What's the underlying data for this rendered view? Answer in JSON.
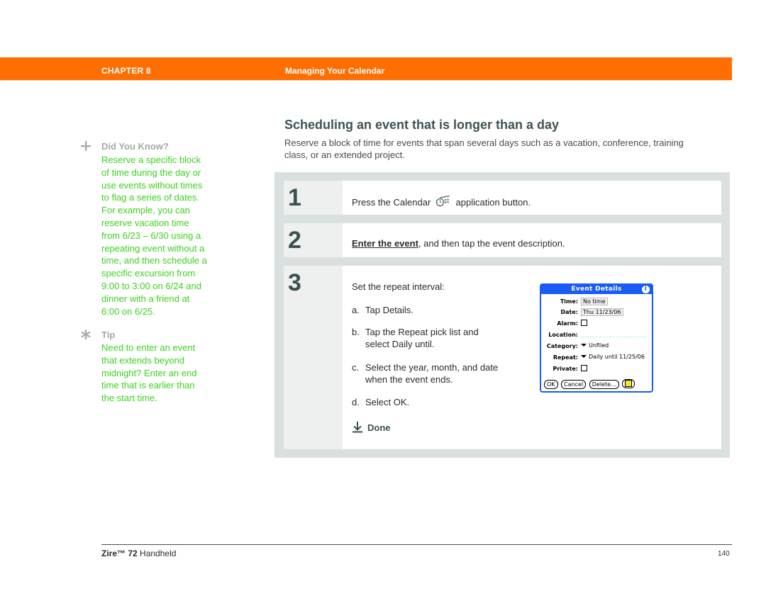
{
  "header": {
    "chapter_label": "CHAPTER 8",
    "chapter_title": "Managing Your Calendar",
    "accent_color": "#ff6e00"
  },
  "sidebar": {
    "did_you_know": {
      "icon": "plus-icon",
      "heading": "Did You Know?",
      "lines": [
        "Reserve a specific block",
        "of time during the day or",
        "use events without times",
        "to flag a series of dates.",
        "For example, you can",
        "reserve vacation time",
        "from 6/23 – 6/30 using a",
        "repeating event without a",
        "time, and then schedule a",
        "specific excursion from",
        "9:00 to 3:00 on 6/24 and",
        "dinner with a friend at",
        "6:00 on 6/25."
      ]
    },
    "tip": {
      "icon": "asterisk-icon",
      "heading": "Tip",
      "lines": [
        "Need to enter an event",
        "that extends beyond",
        "midnight? Enter an end",
        "time that is earlier than",
        "the start time."
      ]
    },
    "text_color": "#3ad21e"
  },
  "main": {
    "title": "Scheduling an event that is longer than a day",
    "intro_lines": [
      "Reserve a block of time for events that span several days such as a vacation, conference, training",
      "class, or an extended project."
    ],
    "steps": [
      {
        "number": "1",
        "text_before": "Press the Calendar",
        "icon": "calendar-button-icon",
        "text_after": "application button."
      },
      {
        "number": "2",
        "link": "Enter the event",
        "text_after": ", and then tap the event description."
      },
      {
        "number": "3",
        "text": "Set the repeat interval:",
        "substeps": [
          {
            "label": "a.",
            "lines": [
              "Tap Details."
            ]
          },
          {
            "label": "b.",
            "lines": [
              "Tap the Repeat pick list and",
              "select Daily until."
            ]
          },
          {
            "label": "c.",
            "lines": [
              "Select the year, month, and date",
              "when the event ends."
            ]
          },
          {
            "label": "d.",
            "lines": [
              "Select OK."
            ]
          }
        ],
        "done_label": "Done"
      }
    ],
    "dialog": {
      "title": "Event Details",
      "info_icon": "info-icon",
      "rows": {
        "time": {
          "label": "Time:",
          "value": "No time"
        },
        "date": {
          "label": "Date:",
          "value": "Thu 11/23/06"
        },
        "alarm": {
          "label": "Alarm:"
        },
        "location": {
          "label": "Location:"
        },
        "category": {
          "label": "Category:",
          "value": "Unfiled"
        },
        "repeat": {
          "label": "Repeat:",
          "value": "Daily until 11/25/06"
        },
        "private": {
          "label": "Private:"
        }
      },
      "buttons": {
        "ok": "OK",
        "cancel": "Cancel",
        "delete": "Delete..."
      },
      "accent_color": "#1a5bf5"
    }
  },
  "footer": {
    "product_bold": "Zire™ 72",
    "product_rest": " Handheld",
    "page_number": "140"
  }
}
